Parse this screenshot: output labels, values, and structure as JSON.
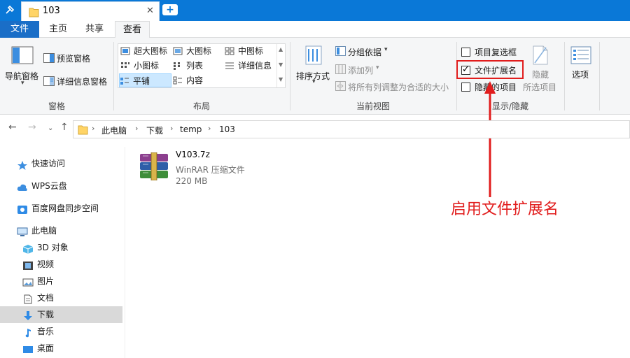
{
  "tab": {
    "title": "103",
    "close": "✕",
    "new_tab": "+"
  },
  "menu": {
    "file": "文件",
    "home": "主页",
    "share": "共享",
    "view": "查看"
  },
  "ribbon": {
    "panes": {
      "nav_pane": "导航窗格",
      "preview_pane": "预览窗格",
      "details_pane": "详细信息窗格",
      "label": "窗格"
    },
    "layout": {
      "items": [
        "超大图标",
        "大图标",
        "中图标",
        "小图标",
        "列表",
        "详细信息",
        "平铺",
        "内容"
      ],
      "selected": "平铺",
      "label": "布局"
    },
    "current_view": {
      "sort_by": "排序方式",
      "group_by": "分组依据",
      "add_column": "添加列",
      "size_all_columns": "将所有列调整为合适的大小",
      "label": "当前视图"
    },
    "show_hide": {
      "item_checkboxes": "项目复选框",
      "item_checkboxes_checked": false,
      "file_extensions": "文件扩展名",
      "file_extensions_checked": true,
      "hidden_items": "隐藏的项目",
      "hidden_items_checked": false,
      "hide": "隐藏",
      "selected_items": "所选项目",
      "label": "显示/隐藏"
    },
    "options": "选项"
  },
  "address": {
    "crumbs": [
      "此电脑",
      "下载",
      "temp",
      "103"
    ]
  },
  "sidebar": {
    "items": [
      "快速访问",
      "WPS云盘",
      "百度网盘同步空间",
      "此电脑",
      "3D 对象",
      "视频",
      "图片",
      "文档",
      "下载",
      "音乐",
      "桌面"
    ],
    "selected": "下载"
  },
  "file": {
    "name": "V103.7z",
    "type": "WinRAR 压缩文件",
    "size": "220 MB"
  },
  "annotation": {
    "text": "启用文件扩展名"
  },
  "colors": {
    "accent": "#0a78d7",
    "annotation": "#e11d1d",
    "selection": "#cce8ff"
  }
}
